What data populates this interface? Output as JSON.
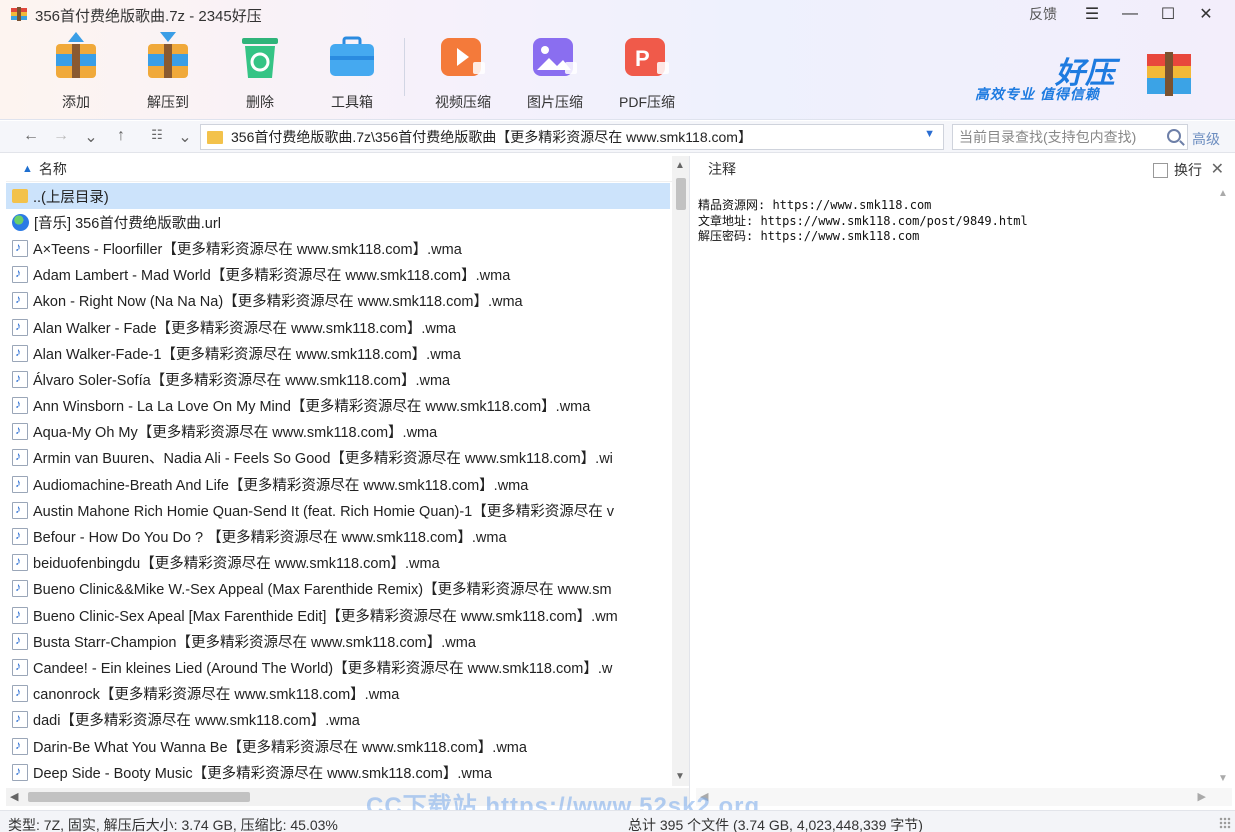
{
  "window": {
    "title": "356首付费绝版歌曲.7z - 2345好压",
    "feedback": "反馈",
    "menu_icon": "menu-icon",
    "minimize_icon": "minimize-icon",
    "maximize_icon": "maximize-icon",
    "close_icon": "close-icon"
  },
  "toolbar": {
    "add": "添加",
    "extract": "解压到",
    "delete": "删除",
    "toolbox": "工具箱",
    "video_compress": "视频压缩",
    "image_compress": "图片压缩",
    "pdf_compress": "PDF压缩"
  },
  "brand": {
    "name": "好压",
    "slogan": "高效专业  值得信赖"
  },
  "navbar": {
    "path": "356首付费绝版歌曲.7z\\356首付费绝版歌曲【更多精彩资源尽在 www.smk118.com】",
    "search_placeholder": "当前目录查找(支持包内查找)",
    "advanced": "高级"
  },
  "filelist": {
    "header": "名称",
    "rows": [
      {
        "icon": "folder-icon",
        "name": "..(上层目录)"
      },
      {
        "icon": "globe-icon",
        "name": "[音乐] 356首付费绝版歌曲.url"
      },
      {
        "icon": "audio-file-icon",
        "name": "A×Teens - Floorfiller【更多精彩资源尽在 www.smk118.com】.wma"
      },
      {
        "icon": "audio-file-icon",
        "name": "Adam Lambert - Mad World【更多精彩资源尽在 www.smk118.com】.wma"
      },
      {
        "icon": "audio-file-icon",
        "name": "Akon - Right Now (Na Na Na)【更多精彩资源尽在 www.smk118.com】.wma"
      },
      {
        "icon": "audio-file-icon",
        "name": "Alan Walker - Fade【更多精彩资源尽在 www.smk118.com】.wma"
      },
      {
        "icon": "audio-file-icon",
        "name": "Alan Walker-Fade-1【更多精彩资源尽在 www.smk118.com】.wma"
      },
      {
        "icon": "audio-file-icon",
        "name": "Álvaro Soler-Sofía【更多精彩资源尽在 www.smk118.com】.wma"
      },
      {
        "icon": "audio-file-icon",
        "name": "Ann Winsborn - La La Love On My Mind【更多精彩资源尽在 www.smk118.com】.wma"
      },
      {
        "icon": "audio-file-icon",
        "name": "Aqua-My Oh My【更多精彩资源尽在 www.smk118.com】.wma"
      },
      {
        "icon": "audio-file-icon",
        "name": "Armin van Buuren、Nadia Ali - Feels So Good【更多精彩资源尽在 www.smk118.com】.wi"
      },
      {
        "icon": "audio-file-icon",
        "name": "Audiomachine-Breath And Life【更多精彩资源尽在 www.smk118.com】.wma"
      },
      {
        "icon": "audio-file-icon",
        "name": "Austin Mahone Rich Homie Quan-Send It (feat. Rich Homie Quan)-1【更多精彩资源尽在 v"
      },
      {
        "icon": "audio-file-icon",
        "name": "Befour - How Do You Do ? 【更多精彩资源尽在 www.smk118.com】.wma"
      },
      {
        "icon": "audio-file-icon",
        "name": "beiduofenbingdu【更多精彩资源尽在 www.smk118.com】.wma"
      },
      {
        "icon": "audio-file-icon",
        "name": "Bueno Clinic&&Mike W.-Sex Appeal (Max Farenthide Remix)【更多精彩资源尽在 www.sm"
      },
      {
        "icon": "audio-file-icon",
        "name": "Bueno Clinic-Sex Apeal [Max Farenthide Edit]【更多精彩资源尽在 www.smk118.com】.wm"
      },
      {
        "icon": "audio-file-icon",
        "name": "Busta Starr-Champion【更多精彩资源尽在 www.smk118.com】.wma"
      },
      {
        "icon": "audio-file-icon",
        "name": "Candee! - Ein kleines Lied (Around The World)【更多精彩资源尽在 www.smk118.com】.w"
      },
      {
        "icon": "audio-file-icon",
        "name": "canonrock【更多精彩资源尽在 www.smk118.com】.wma"
      },
      {
        "icon": "audio-file-icon",
        "name": "dadi【更多精彩资源尽在 www.smk118.com】.wma"
      },
      {
        "icon": "audio-file-icon",
        "name": "Darin-Be What You Wanna Be【更多精彩资源尽在 www.smk118.com】.wma"
      },
      {
        "icon": "audio-file-icon",
        "name": "Deep Side - Booty Music【更多精彩资源尽在 www.smk118.com】.wma"
      }
    ]
  },
  "comment": {
    "header": "注释",
    "wrap_label": "换行",
    "lines": [
      "精品资源网: https://www.smk118.com",
      "文章地址: https://www.smk118.com/post/9849.html",
      "解压密码: https://www.smk118.com"
    ]
  },
  "watermark": "CC下载站 https://www.52sk2.org",
  "status": {
    "left": "类型: 7Z, 固实, 解压后大小: 3.74 GB, 压缩比: 45.03%",
    "right": "总计 395 个文件 (3.74 GB, 4,023,448,339 字节)"
  },
  "colors": {
    "accent": "#1e7be0",
    "selection": "#cce3fb",
    "folder": "#f3c24b"
  }
}
